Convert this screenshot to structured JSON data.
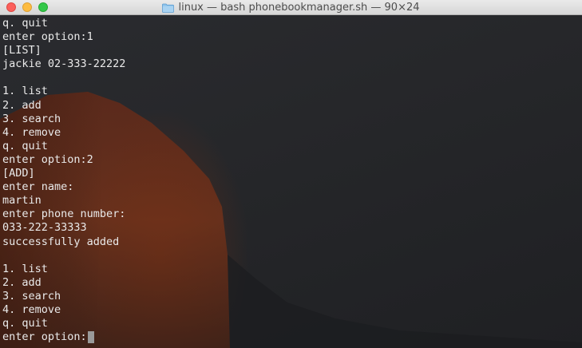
{
  "window": {
    "title": "linux — bash phonebookmanager.sh — 90×24",
    "folder_icon": "folder-icon"
  },
  "colors": {
    "close": "#fc605c",
    "minimize": "#fdbc40",
    "maximize": "#34c84a",
    "terminal_text": "#eaeaea"
  },
  "terminal": {
    "lines": [
      "q. quit",
      "enter option:1",
      "[LIST]",
      "jackie 02-333-22222",
      "",
      "1. list",
      "2. add",
      "3. search",
      "4. remove",
      "q. quit",
      "enter option:2",
      "[ADD]",
      "enter name:",
      "martin",
      "enter phone number:",
      "033-222-33333",
      "successfully added",
      "",
      "1. list",
      "2. add",
      "3. search",
      "4. remove",
      "q. quit"
    ],
    "prompt": "enter option:"
  }
}
